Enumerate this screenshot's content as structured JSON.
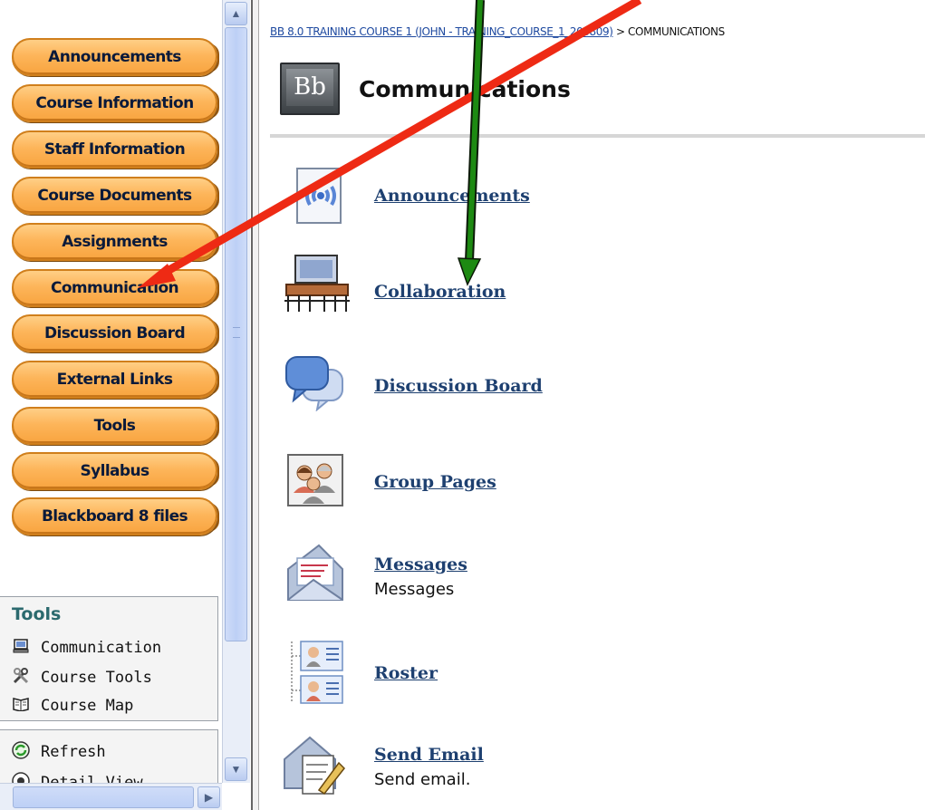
{
  "course_menu": {
    "buttons": [
      {
        "label": "Announcements"
      },
      {
        "label": "Course Information"
      },
      {
        "label": "Staff Information"
      },
      {
        "label": "Course Documents"
      },
      {
        "label": "Assignments"
      },
      {
        "label": "Communication"
      },
      {
        "label": "Discussion Board"
      },
      {
        "label": "External Links"
      },
      {
        "label": "Tools"
      },
      {
        "label": "Syllabus"
      },
      {
        "label": "Blackboard 8 files"
      }
    ]
  },
  "tools_panel": {
    "header": "Tools",
    "items": [
      {
        "label": "Communication",
        "icon": "computer-icon"
      },
      {
        "label": "Course Tools",
        "icon": "tools-icon"
      },
      {
        "label": "Course Map",
        "icon": "map-icon"
      }
    ]
  },
  "view_panel": {
    "items": [
      {
        "label": "Refresh",
        "icon": "refresh-icon"
      },
      {
        "label": "Detail View",
        "icon": "detail-view-icon"
      }
    ]
  },
  "breadcrumb": {
    "link": "BB 8.0 TRAINING COURSE 1 (JOHN - TRAINING_COURSE_1_200809)",
    "separator": ">",
    "current": "COMMUNICATIONS"
  },
  "page": {
    "logo_text": "Bb",
    "title": "Communications"
  },
  "tools": [
    {
      "label": "Announcements",
      "desc": "",
      "icon": "announcements-icon"
    },
    {
      "label": "Collaboration",
      "desc": "",
      "icon": "collaboration-icon"
    },
    {
      "label": "Discussion Board",
      "desc": "",
      "icon": "discussion-board-icon"
    },
    {
      "label": "Group Pages",
      "desc": "",
      "icon": "group-pages-icon"
    },
    {
      "label": "Messages",
      "desc": "Messages",
      "icon": "messages-icon"
    },
    {
      "label": "Roster",
      "desc": "",
      "icon": "roster-icon"
    },
    {
      "label": "Send Email",
      "desc": "Send email.",
      "icon": "send-email-icon"
    }
  ],
  "annotations": {
    "red_arrow_color": "#ee2a14",
    "green_arrow_color": "#1d8a12"
  }
}
